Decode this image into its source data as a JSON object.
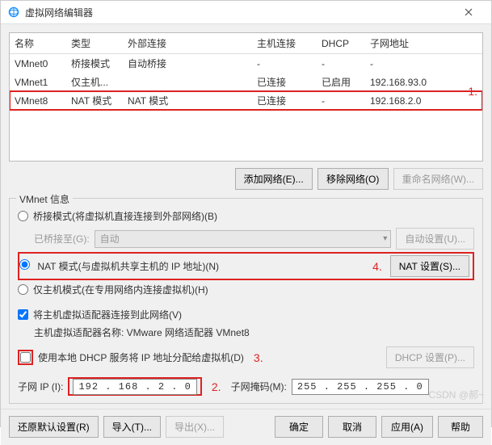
{
  "window": {
    "title": "虚拟网络编辑器"
  },
  "table": {
    "headers": {
      "name": "名称",
      "type": "类型",
      "ext": "外部连接",
      "host": "主机连接",
      "dhcp": "DHCP",
      "subnet": "子网地址"
    },
    "rows": [
      {
        "name": "VMnet0",
        "type": "桥接模式",
        "ext": "自动桥接",
        "host": "-",
        "dhcp": "-",
        "subnet": "-"
      },
      {
        "name": "VMnet1",
        "type": "仅主机...",
        "ext": "",
        "host": "已连接",
        "dhcp": "已启用",
        "subnet": "192.168.93.0"
      },
      {
        "name": "VMnet8",
        "type": "NAT 模式",
        "ext": "NAT 模式",
        "host": "已连接",
        "dhcp": "-",
        "subnet": "192.168.2.0"
      }
    ]
  },
  "annot": {
    "a1": "1.",
    "a2": "2.",
    "a3": "3.",
    "a4": "4."
  },
  "btns": {
    "add": "添加网络(E)...",
    "remove": "移除网络(O)",
    "rename": "重命名网络(W)..."
  },
  "group": {
    "title": "VMnet 信息",
    "bridged": "桥接模式(将虚拟机直接连接到外部网络)(B)",
    "bridged_to": "已桥接至(G):",
    "bridged_combo": "自动",
    "auto_btn": "自动设置(U)...",
    "nat": "NAT 模式(与虚拟机共享主机的 IP 地址)(N)",
    "nat_btn": "NAT 设置(S)...",
    "hostonly": "仅主机模式(在专用网络内连接虚拟机)(H)",
    "host_conn": "将主机虚拟适配器连接到此网络(V)",
    "host_adapter_label": "主机虚拟适配器名称: ",
    "host_adapter_value": "VMware 网络适配器 VMnet8",
    "dhcp_cb": "使用本地 DHCP 服务将 IP 地址分配给虚拟机(D)",
    "dhcp_btn": "DHCP 设置(P)...",
    "subnet_ip_label": "子网 IP (I):",
    "subnet_ip": "192 . 168 .  2  .  0",
    "mask_label": "子网掩码(M):",
    "mask": "255 . 255 . 255 .  0"
  },
  "bottom": {
    "restore": "还原默认设置(R)",
    "import": "导入(T)...",
    "export": "导出(X)...",
    "ok": "确定",
    "cancel": "取消",
    "apply": "应用(A)",
    "help": "帮助"
  },
  "watermark": "CSDN @郝~"
}
